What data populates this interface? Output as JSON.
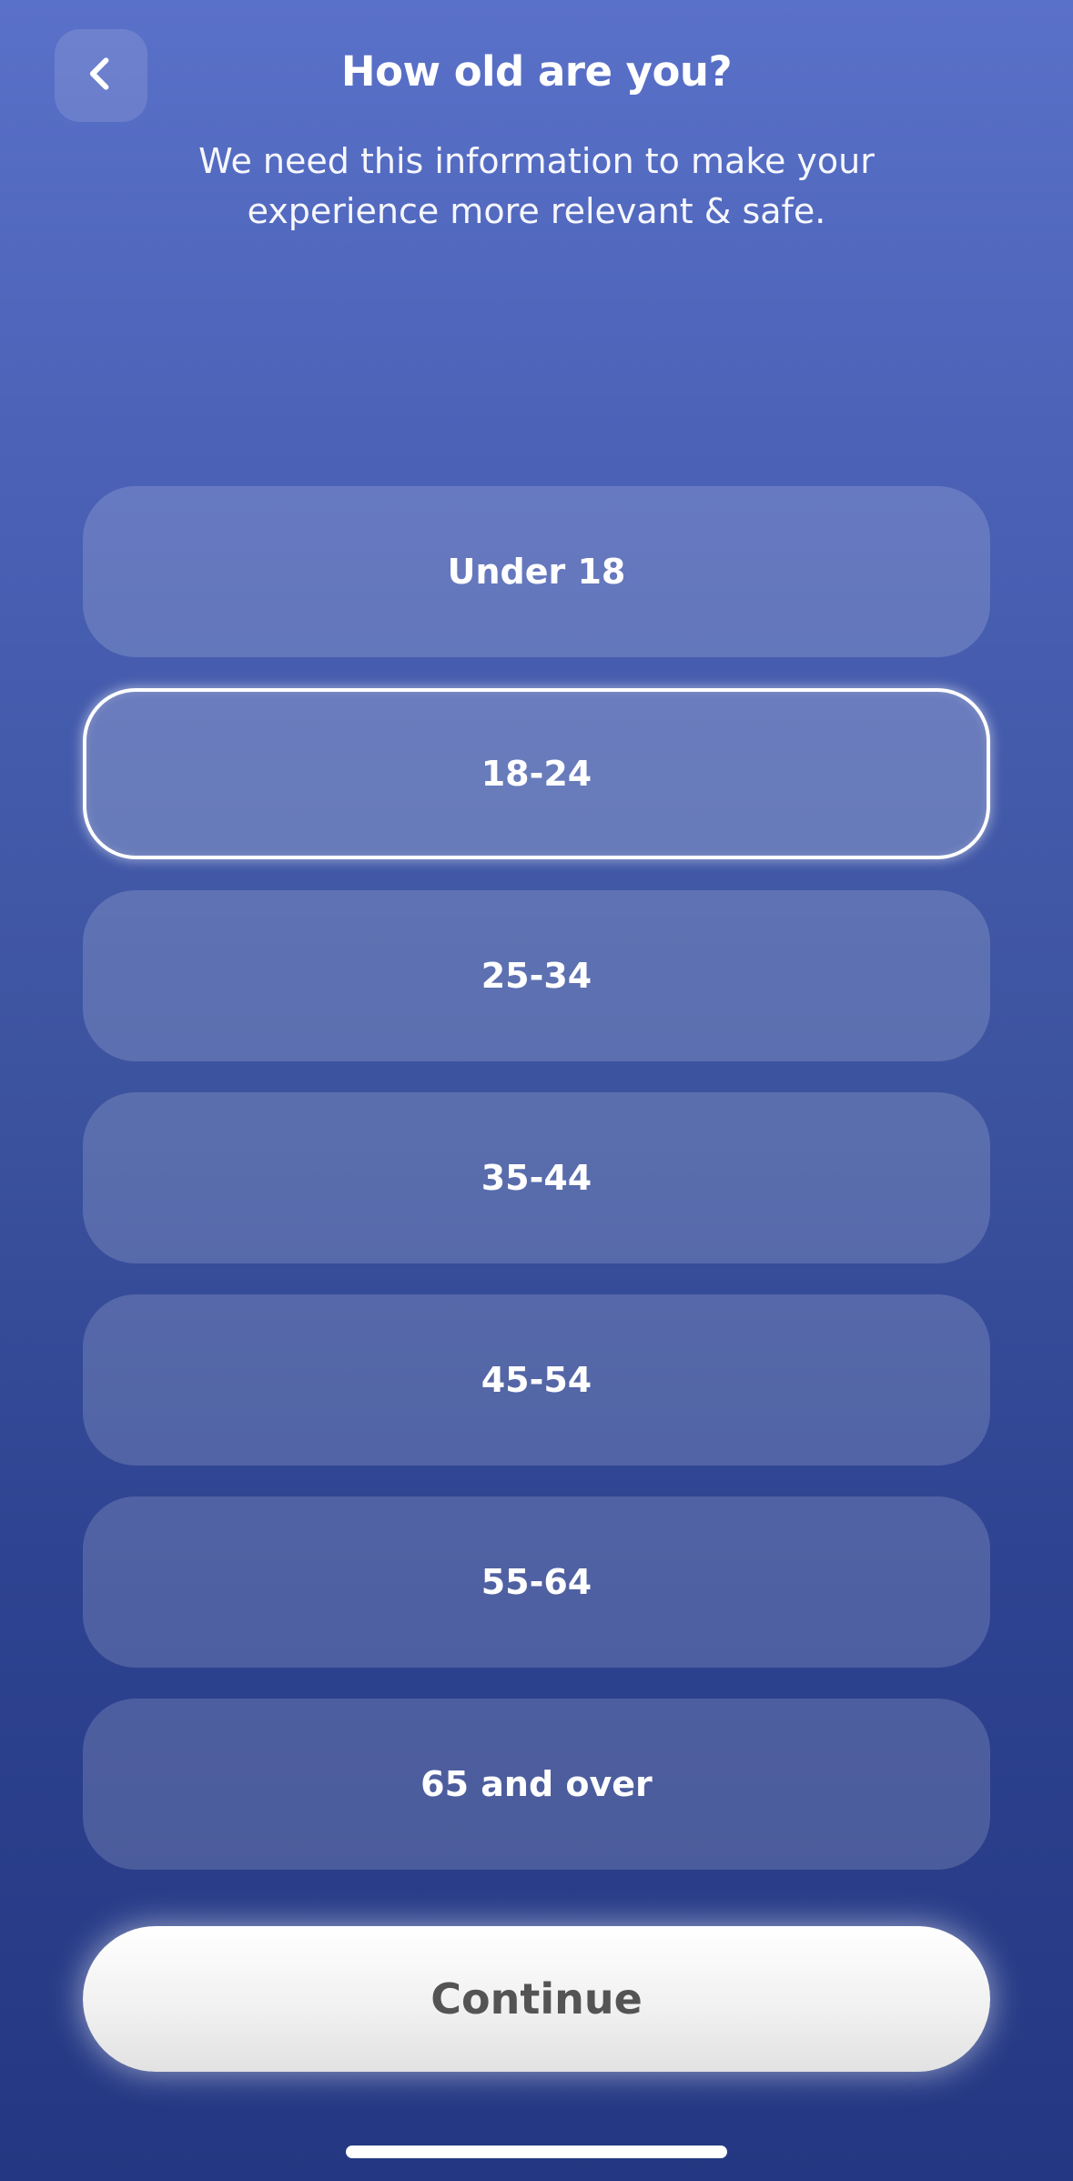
{
  "header": {
    "back_icon": "chevron-left-icon",
    "title": "How old are you?",
    "subtitle": "We need this information to make your experience more relevant & safe."
  },
  "options": [
    {
      "label": "Under 18",
      "selected": false
    },
    {
      "label": "18-24",
      "selected": true
    },
    {
      "label": "25-34",
      "selected": false
    },
    {
      "label": "35-44",
      "selected": false
    },
    {
      "label": "45-54",
      "selected": false
    },
    {
      "label": "55-64",
      "selected": false
    },
    {
      "label": "65 and over",
      "selected": false
    }
  ],
  "footer": {
    "continue_label": "Continue"
  },
  "colors": {
    "background_top": "#5a71c9",
    "background_bottom": "#243782",
    "continue_text": "#545454"
  }
}
